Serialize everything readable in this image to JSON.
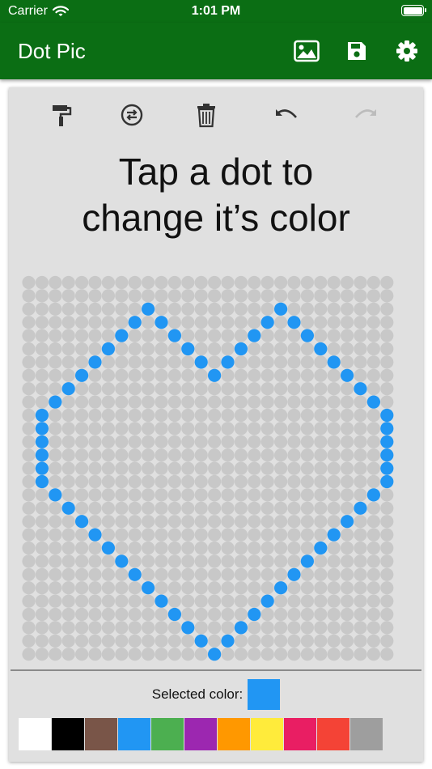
{
  "status_bar": {
    "carrier": "Carrier",
    "time": "1:01 PM"
  },
  "app_bar": {
    "title": "Dot Pic",
    "actions": [
      {
        "name": "image-icon"
      },
      {
        "name": "save-icon"
      },
      {
        "name": "settings-icon"
      }
    ]
  },
  "toolbar": {
    "buttons": [
      {
        "name": "paint-roller-icon",
        "enabled": true
      },
      {
        "name": "swap-colors-icon",
        "enabled": true
      },
      {
        "name": "trash-icon",
        "enabled": true
      },
      {
        "name": "undo-icon",
        "enabled": true
      },
      {
        "name": "redo-icon",
        "enabled": false
      }
    ]
  },
  "instructions": {
    "line1": "Tap a dot to",
    "line2": "change it’s color"
  },
  "grid": {
    "columns": 28,
    "rows": 29,
    "empty_color": "#c8c8c8",
    "paint_color": "#2196f3",
    "painted": [
      [
        2,
        9
      ],
      [
        2,
        19
      ],
      [
        3,
        8
      ],
      [
        3,
        10
      ],
      [
        3,
        18
      ],
      [
        3,
        20
      ],
      [
        4,
        7
      ],
      [
        4,
        11
      ],
      [
        4,
        17
      ],
      [
        4,
        21
      ],
      [
        5,
        6
      ],
      [
        5,
        12
      ],
      [
        5,
        16
      ],
      [
        5,
        22
      ],
      [
        6,
        5
      ],
      [
        6,
        13
      ],
      [
        6,
        15
      ],
      [
        6,
        23
      ],
      [
        7,
        4
      ],
      [
        7,
        14
      ],
      [
        7,
        24
      ],
      [
        8,
        3
      ],
      [
        8,
        25
      ],
      [
        9,
        2
      ],
      [
        9,
        26
      ],
      [
        10,
        1
      ],
      [
        10,
        27
      ],
      [
        11,
        1
      ],
      [
        11,
        27
      ],
      [
        12,
        1
      ],
      [
        12,
        27
      ],
      [
        13,
        1
      ],
      [
        13,
        27
      ],
      [
        14,
        1
      ],
      [
        14,
        27
      ],
      [
        15,
        1
      ],
      [
        15,
        27
      ],
      [
        16,
        2
      ],
      [
        16,
        26
      ],
      [
        17,
        3
      ],
      [
        17,
        25
      ],
      [
        18,
        4
      ],
      [
        18,
        24
      ],
      [
        19,
        5
      ],
      [
        19,
        23
      ],
      [
        20,
        6
      ],
      [
        20,
        22
      ],
      [
        21,
        7
      ],
      [
        21,
        21
      ],
      [
        22,
        8
      ],
      [
        22,
        20
      ],
      [
        23,
        9
      ],
      [
        23,
        19
      ],
      [
        24,
        10
      ],
      [
        24,
        18
      ],
      [
        25,
        11
      ],
      [
        25,
        17
      ],
      [
        26,
        12
      ],
      [
        26,
        16
      ],
      [
        27,
        13
      ],
      [
        27,
        15
      ],
      [
        28,
        14
      ]
    ]
  },
  "selected_color": {
    "label": "Selected color:",
    "value": "#2196f3"
  },
  "palette": [
    {
      "name": "white",
      "color": "#ffffff"
    },
    {
      "name": "black",
      "color": "#000000"
    },
    {
      "name": "brown",
      "color": "#795548"
    },
    {
      "name": "blue",
      "color": "#2196f3"
    },
    {
      "name": "green",
      "color": "#4caf50"
    },
    {
      "name": "purple",
      "color": "#9c27b0"
    },
    {
      "name": "orange",
      "color": "#ff9800"
    },
    {
      "name": "yellow",
      "color": "#ffeb3b"
    },
    {
      "name": "pink",
      "color": "#e91e63"
    },
    {
      "name": "red",
      "color": "#f44336"
    },
    {
      "name": "grey",
      "color": "#9e9e9e"
    }
  ]
}
